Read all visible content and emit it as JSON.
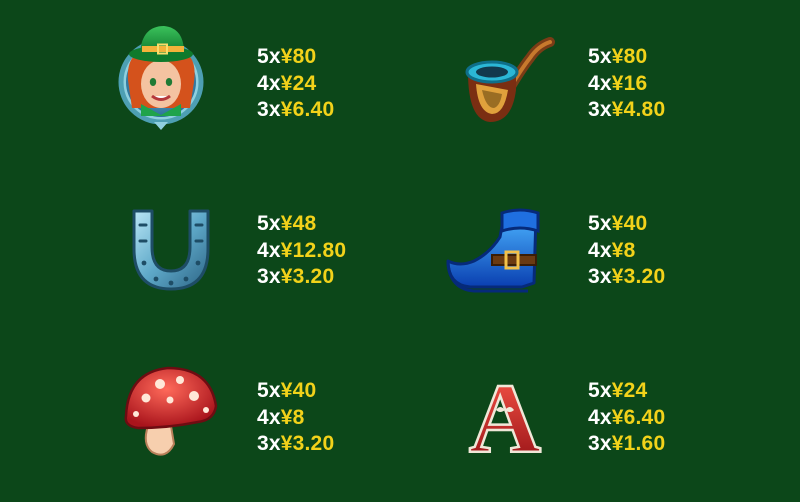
{
  "colors": {
    "background": "#0c4719",
    "multiplier_text": "#ffffff",
    "payout_text": "#f2d21a"
  },
  "paytable": [
    {
      "symbol": "leprechaun-icon",
      "pays": [
        {
          "count": "5x",
          "amount": "¥80"
        },
        {
          "count": "4x",
          "amount": "¥24"
        },
        {
          "count": "3x",
          "amount": "¥6.40"
        }
      ]
    },
    {
      "symbol": "pipe-icon",
      "pays": [
        {
          "count": "5x",
          "amount": "¥80"
        },
        {
          "count": "4x",
          "amount": "¥16"
        },
        {
          "count": "3x",
          "amount": "¥4.80"
        }
      ]
    },
    {
      "symbol": "horseshoe-icon",
      "pays": [
        {
          "count": "5x",
          "amount": "¥48"
        },
        {
          "count": "4x",
          "amount": "¥12.80"
        },
        {
          "count": "3x",
          "amount": "¥3.20"
        }
      ]
    },
    {
      "symbol": "boot-icon",
      "pays": [
        {
          "count": "5x",
          "amount": "¥40"
        },
        {
          "count": "4x",
          "amount": "¥8"
        },
        {
          "count": "3x",
          "amount": "¥3.20"
        }
      ]
    },
    {
      "symbol": "mushroom-icon",
      "pays": [
        {
          "count": "5x",
          "amount": "¥40"
        },
        {
          "count": "4x",
          "amount": "¥8"
        },
        {
          "count": "3x",
          "amount": "¥3.20"
        }
      ]
    },
    {
      "symbol": "letter-a-icon",
      "glyph": "A",
      "pays": [
        {
          "count": "5x",
          "amount": "¥24"
        },
        {
          "count": "4x",
          "amount": "¥6.40"
        },
        {
          "count": "3x",
          "amount": "¥1.60"
        }
      ]
    }
  ]
}
